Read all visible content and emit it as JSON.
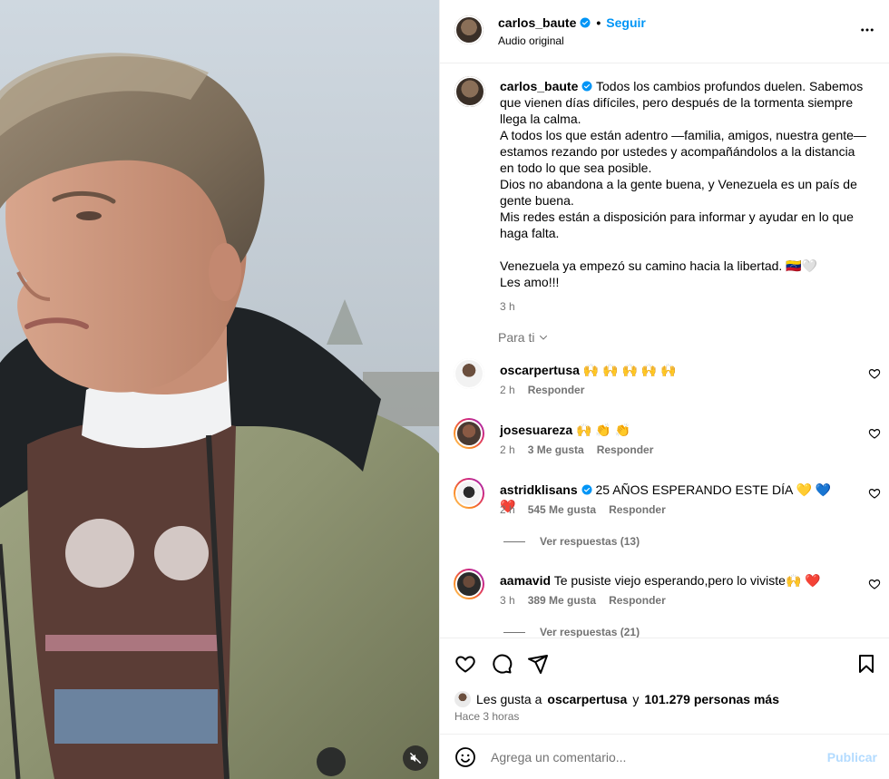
{
  "post": {
    "author": "carlos_baute",
    "follow_label": "Seguir",
    "audio": "Audio original",
    "more_icon": "more-options-icon",
    "caption_lines": [
      "Todos los cambios profundos duelen. Sabemos",
      "que vienen días difíciles, pero después de la tormenta siempre",
      "llega la calma.",
      "A todos los que están adentro —familia, amigos, nuestra gente—",
      "estamos rezando por ustedes y acompañándolos a la distancia",
      "en todo lo que sea posible.",
      "Dios no abandona a la gente buena, y Venezuela es un país de",
      "gente buena.",
      "Mis redes están a disposición para informar y ayudar en lo que",
      "haga falta.",
      "",
      "Venezuela ya empezó su camino hacia la libertad. 🇻🇪🤍",
      "Les amo!!!"
    ],
    "caption_time": "3 h",
    "for_you": "Para ti"
  },
  "comments": [
    {
      "user": "oscarpertusa",
      "verified": false,
      "text": "🙌 🙌 🙌 🙌 🙌",
      "time": "2 h",
      "likes": "",
      "reply": "Responder"
    },
    {
      "user": "josesuareza",
      "verified": false,
      "text": "🙌 👏 👏",
      "time": "2 h",
      "likes": "3 Me gusta",
      "reply": "Responder"
    },
    {
      "user": "astridklisans",
      "verified": true,
      "text": "25 AÑOS ESPERANDO ESTE DÍA 💛 💙 ❤️",
      "time": "2 h",
      "likes": "545 Me gusta",
      "reply": "Responder"
    },
    {
      "user": "aamavid",
      "verified": false,
      "text": "Te pusiste viejo esperando,pero lo viviste🙌 ❤️",
      "time": "3 h",
      "likes": "389 Me gusta",
      "reply": "Responder"
    }
  ],
  "view_replies": [
    "Ver respuestas (13)",
    "Ver respuestas (21)"
  ],
  "footer": {
    "liked_prefix": "Les gusta a",
    "liked_user": "oscarpertusa",
    "liked_and": "y",
    "liked_count": "101.279 personas más",
    "posted": "Hace 3 horas",
    "comment_placeholder": "Agrega un comentario...",
    "publish_label": "Publicar"
  },
  "colors": {
    "accent": "#0095f6",
    "publish_disabled": "#b3dbff",
    "muted": "#737373",
    "jacket": "#8e9472"
  }
}
